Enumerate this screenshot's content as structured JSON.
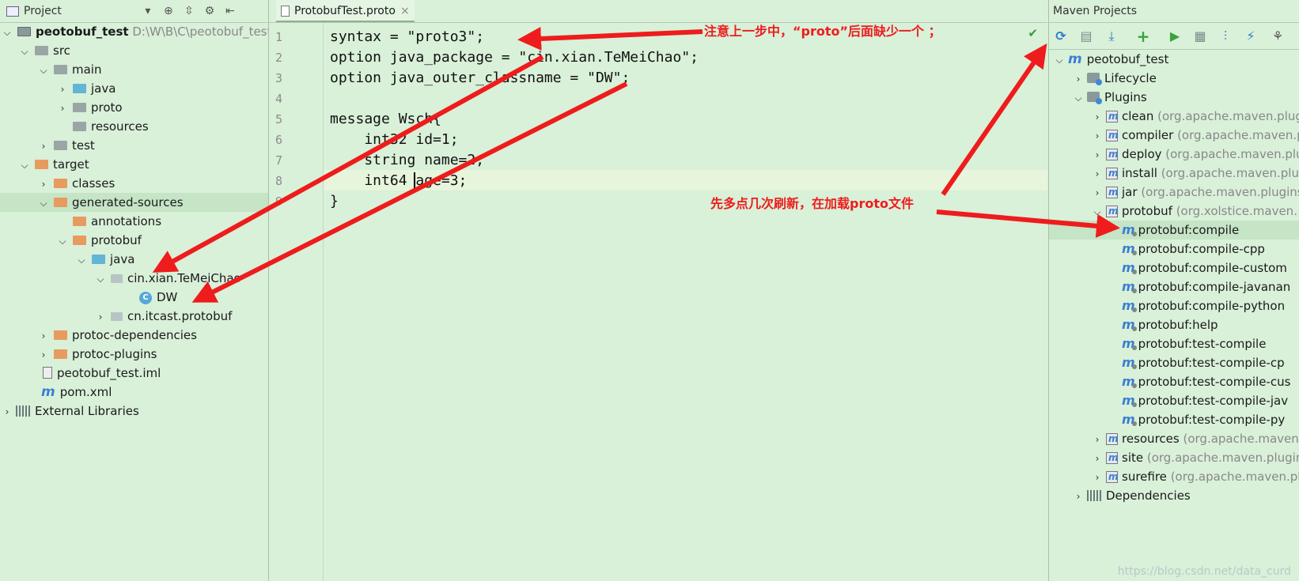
{
  "project_panel": {
    "title": "Project",
    "tree": [
      {
        "label": "peotobuf_test",
        "path": "D:\\W\\B\\C\\peotobuf_test",
        "icon": "module-folder-icon"
      },
      {
        "label": "src",
        "icon": "folder-icon"
      },
      {
        "label": "main",
        "icon": "folder-icon"
      },
      {
        "label": "java",
        "icon": "source-folder-icon"
      },
      {
        "label": "proto",
        "icon": "folder-icon"
      },
      {
        "label": "resources",
        "icon": "resources-folder-icon"
      },
      {
        "label": "test",
        "icon": "folder-icon"
      },
      {
        "label": "target",
        "icon": "excluded-folder-icon"
      },
      {
        "label": "classes",
        "icon": "excluded-folder-icon"
      },
      {
        "label": "generated-sources",
        "icon": "excluded-folder-icon"
      },
      {
        "label": "annotations",
        "icon": "excluded-folder-icon"
      },
      {
        "label": "protobuf",
        "icon": "excluded-folder-icon"
      },
      {
        "label": "java",
        "icon": "source-folder-icon"
      },
      {
        "label": "cin.xian.TeMeiChao",
        "icon": "package-icon"
      },
      {
        "label": "DW",
        "icon": "class-icon"
      },
      {
        "label": "cn.itcast.protobuf",
        "icon": "package-icon"
      },
      {
        "label": "protoc-dependencies",
        "icon": "excluded-folder-icon"
      },
      {
        "label": "protoc-plugins",
        "icon": "excluded-folder-icon"
      },
      {
        "label": "peotobuf_test.iml",
        "icon": "iml-file-icon"
      },
      {
        "label": "pom.xml",
        "icon": "maven-file-icon"
      },
      {
        "label": "External Libraries",
        "icon": "library-icon"
      }
    ]
  },
  "editor": {
    "tab_label": "ProtobufTest.proto",
    "lines": [
      {
        "num": "1",
        "text": "syntax = \"proto3\";"
      },
      {
        "num": "2",
        "text": "option java_package = \"cin.xian.TeMeiChao\";"
      },
      {
        "num": "3",
        "text": "option java_outer_classname = \"DW\";"
      },
      {
        "num": "4",
        "text": ""
      },
      {
        "num": "5",
        "text": "message Wsch{"
      },
      {
        "num": "6",
        "text": "    int32 id=1;"
      },
      {
        "num": "7",
        "text": "    string name=2;"
      },
      {
        "num": "8",
        "text": "    int64 age=3;"
      },
      {
        "num": "9",
        "text": "}"
      }
    ]
  },
  "maven_panel": {
    "title": "Maven Projects",
    "toolbar": [
      "reimport-icon",
      "generate-sources-icon",
      "download-icon",
      "add-icon",
      "run-icon",
      "execute-goal-icon",
      "toggle-offline-icon",
      "skip-tests-icon",
      "show-dependencies-icon"
    ],
    "tree": [
      {
        "label": "peotobuf_test",
        "detail": ""
      },
      {
        "label": "Lifecycle",
        "detail": ""
      },
      {
        "label": "Plugins",
        "detail": ""
      },
      {
        "label": "clean",
        "detail": "(org.apache.maven.plug"
      },
      {
        "label": "compiler",
        "detail": "(org.apache.maven.p"
      },
      {
        "label": "deploy",
        "detail": "(org.apache.maven.plu"
      },
      {
        "label": "install",
        "detail": "(org.apache.maven.plu"
      },
      {
        "label": "jar",
        "detail": "(org.apache.maven.plugins"
      },
      {
        "label": "protobuf",
        "detail": "(org.xolstice.maven."
      },
      {
        "label": "protobuf:compile",
        "detail": ""
      },
      {
        "label": "protobuf:compile-cpp",
        "detail": ""
      },
      {
        "label": "protobuf:compile-custom",
        "detail": ""
      },
      {
        "label": "protobuf:compile-javanan",
        "detail": ""
      },
      {
        "label": "protobuf:compile-python",
        "detail": ""
      },
      {
        "label": "protobuf:help",
        "detail": ""
      },
      {
        "label": "protobuf:test-compile",
        "detail": ""
      },
      {
        "label": "protobuf:test-compile-cp",
        "detail": ""
      },
      {
        "label": "protobuf:test-compile-cus",
        "detail": ""
      },
      {
        "label": "protobuf:test-compile-jav",
        "detail": ""
      },
      {
        "label": "protobuf:test-compile-py",
        "detail": ""
      },
      {
        "label": "resources",
        "detail": "(org.apache.maven"
      },
      {
        "label": "site",
        "detail": "(org.apache.maven.plugin"
      },
      {
        "label": "surefire",
        "detail": "(org.apache.maven.pl"
      },
      {
        "label": "Dependencies",
        "detail": ""
      }
    ]
  },
  "annotations": {
    "note_top": "注意上一步中，“proto”后面缺少一个 ；",
    "note_mid": "先多点几次刷新，在加载proto文件"
  },
  "watermark": "https://blog.csdn.net/data_curd",
  "colors": {
    "background": "#d9f0d9",
    "arrow": "#ee1c1c",
    "selection": "#c6e4c6"
  }
}
